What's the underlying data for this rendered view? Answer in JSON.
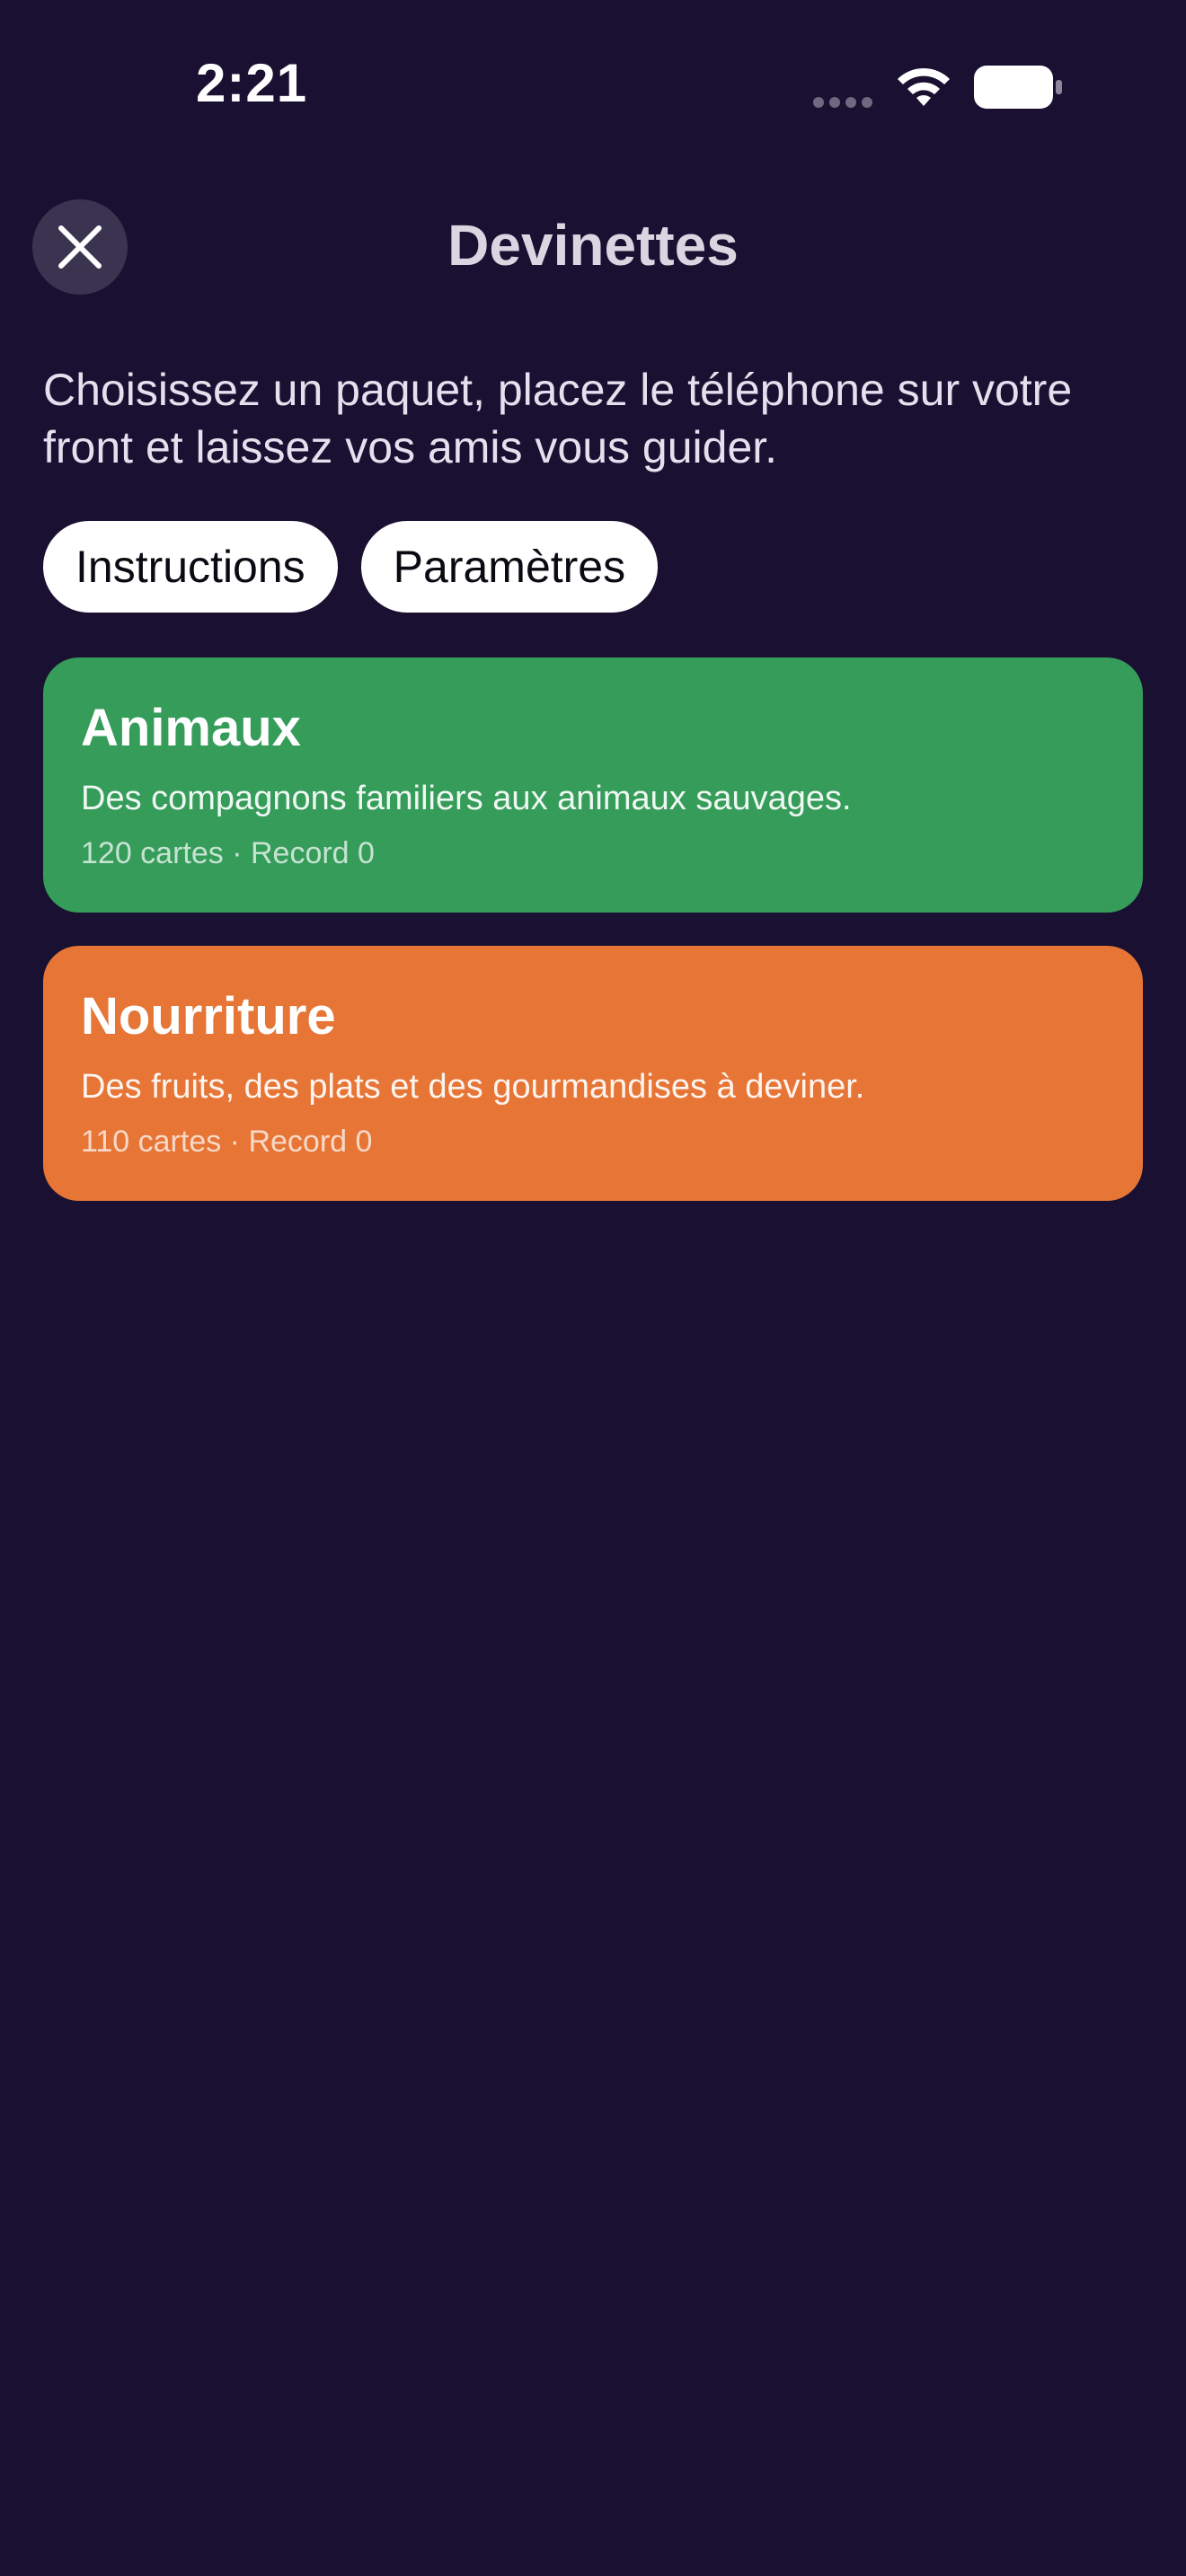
{
  "status_bar": {
    "time": "2:21",
    "signal_icon": "signal-dots-icon",
    "wifi_icon": "wifi-icon",
    "battery_icon": "battery-icon"
  },
  "header": {
    "title": "Devinettes",
    "close_icon": "close-icon"
  },
  "intro": "Choisissez un paquet, placez le téléphone sur votre front et laissez vos amis vous guider.",
  "buttons": {
    "instructions": "Instructions",
    "settings": "Paramètres"
  },
  "packs": [
    {
      "title": "Animaux",
      "description": "Des compagnons familiers aux animaux sauvages.",
      "meta": "120 cartes · Record 0",
      "color": "#359c5a"
    },
    {
      "title": "Nourriture",
      "description": "Des fruits, des plats et des gourmandises à deviner.",
      "meta": "110 cartes · Record 0",
      "color": "#e67536"
    }
  ],
  "colors": {
    "background": "#1a1132",
    "close_button": "#3a3450",
    "title": "#d9d6e2"
  }
}
